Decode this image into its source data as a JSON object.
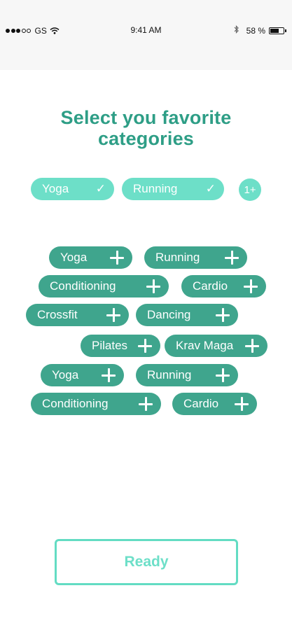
{
  "status_bar": {
    "carrier": "GS",
    "time": "9:41 AM",
    "battery_percent": "58 %",
    "battery_level": 0.58,
    "icons": [
      "signal-dots-icon",
      "wifi-icon",
      "bluetooth-icon",
      "battery-icon"
    ]
  },
  "title": {
    "line1": "Select you favorite",
    "line2": "categories"
  },
  "selected": {
    "items": [
      {
        "label": "Yoga",
        "check": "✓"
      },
      {
        "label": "Running",
        "check": "✓"
      }
    ],
    "more_label": "1+"
  },
  "categories": [
    {
      "label": "Yoga"
    },
    {
      "label": "Running"
    },
    {
      "label": "Conditioning"
    },
    {
      "label": "Cardio"
    },
    {
      "label": "Crossfit"
    },
    {
      "label": "Dancing"
    },
    {
      "label": "Pilates"
    },
    {
      "label": "Krav Maga"
    },
    {
      "label": "Yoga"
    },
    {
      "label": "Running"
    },
    {
      "label": "Conditioning"
    },
    {
      "label": "Cardio"
    }
  ],
  "ready_button": {
    "label": "Ready"
  },
  "colors": {
    "title": "#2e9e86",
    "selected_chip": "#6ddfc8",
    "category_chip": "#3fa58d",
    "ready_border": "#63dcc3"
  }
}
